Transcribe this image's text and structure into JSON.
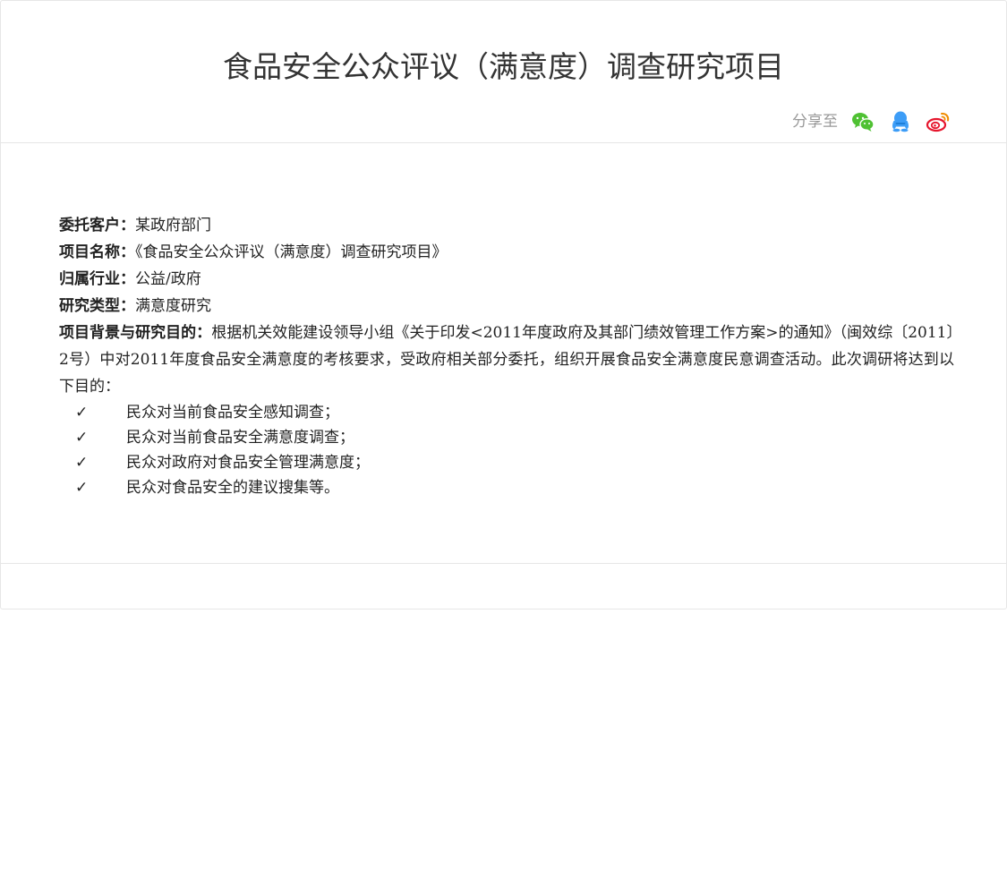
{
  "article": {
    "title": "食品安全公众评议（满意度）调查研究项目",
    "share": {
      "label": "分享至",
      "targets": [
        {
          "name": "wechat",
          "icon": "wechat-icon",
          "color": "#4fc133"
        },
        {
          "name": "qq",
          "icon": "qq-icon",
          "color": "#3d9df7"
        },
        {
          "name": "weibo",
          "icon": "weibo-icon",
          "color": "#e6162d"
        }
      ]
    }
  },
  "details": {
    "client_label": "委托客户：",
    "client_value": "某政府部门",
    "project_label": "项目名称：",
    "project_value": "《食品安全公众评议（满意度）调查研究项目》",
    "industry_label": "归属行业：",
    "industry_value": "公益/政府",
    "type_label": "研究类型：",
    "type_value": "满意度研究",
    "background_label": "项目背景与研究目的：",
    "background_value": "根据机关效能建设领导小组《关于印发<2011年度政府及其部门绩效管理工作方案>的通知》（闽效综〔2011〕2号）中对2011年度食品安全满意度的考核要求，受政府相关部分委托，组织开展食品安全满意度民意调查活动。此次调研将达到以下目的：",
    "goals": [
      "民众对当前食品安全感知调查；",
      "民众对当前食品安全满意度调查；",
      "民众对政府对食品安全管理满意度；",
      "民众对食品安全的建议搜集等。"
    ],
    "check_glyph": "✓"
  }
}
